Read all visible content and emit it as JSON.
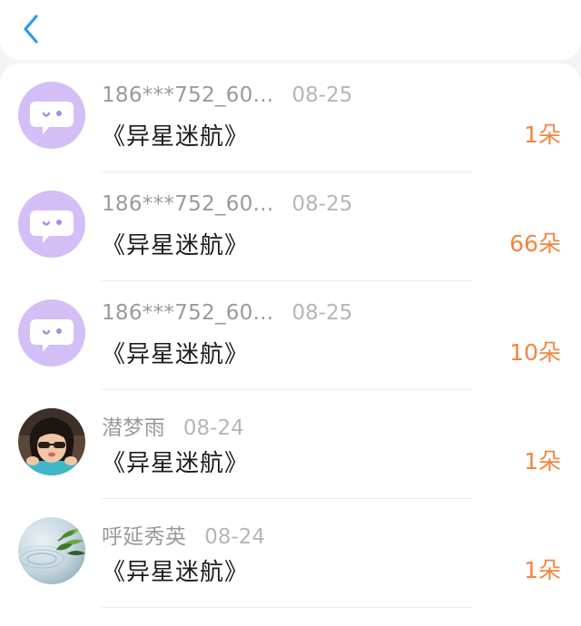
{
  "header": {
    "back_icon": "chevron-left-icon",
    "accent_color": "#2a9af3"
  },
  "records": [
    {
      "avatar": "chat-bubble-icon",
      "user": "186***752_60...",
      "date": "08-25",
      "title": "《异星迷航》",
      "count": "1朵"
    },
    {
      "avatar": "chat-bubble-icon",
      "user": "186***752_60...",
      "date": "08-25",
      "title": "《异星迷航》",
      "count": "66朵"
    },
    {
      "avatar": "chat-bubble-icon",
      "user": "186***752_60...",
      "date": "08-25",
      "title": "《异星迷航》",
      "count": "10朵"
    },
    {
      "avatar": "photo-girl",
      "user": "潜梦雨",
      "date": "08-24",
      "title": "《异星迷航》",
      "count": "1朵"
    },
    {
      "avatar": "photo-bamboo",
      "user": "呼延秀英",
      "date": "08-24",
      "title": "《异星迷航》",
      "count": "1朵"
    }
  ],
  "colors": {
    "count": "#f2863f",
    "default_avatar_bg": "#d4bef6"
  }
}
